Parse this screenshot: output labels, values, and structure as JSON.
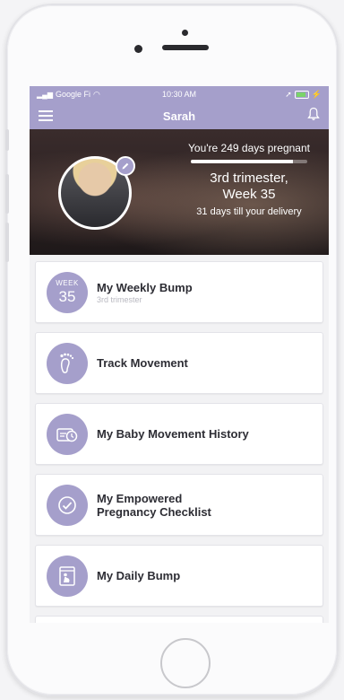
{
  "status_bar": {
    "carrier": "Google Fi",
    "time": "10:30 AM"
  },
  "header": {
    "title": "Sarah",
    "menu_icon": "menu-icon",
    "bell_icon": "bell-icon"
  },
  "hero": {
    "pregnant_days": "You're 249 days pregnant",
    "progress_fraction": 0.88,
    "trimester_line1": "3rd trimester,",
    "trimester_line2": "Week 35",
    "delivery": "31 days till your delivery"
  },
  "cards": [
    {
      "title": "My Weekly Bump",
      "subtitle": "3rd trimester",
      "badge_top": "WEEK",
      "badge_num": "35",
      "icon": "week-badge"
    },
    {
      "title": "Track Movement",
      "icon": "footprint-icon"
    },
    {
      "title": "My Baby Movement History",
      "icon": "history-icon"
    },
    {
      "title_line1": "My Empowered",
      "title_line2": "Pregnancy Checklist",
      "icon": "check-circle-icon"
    },
    {
      "title": "My Daily Bump",
      "icon": "daily-bump-icon"
    }
  ],
  "colors": {
    "accent": "#a59fcb",
    "title_text": "#2d2d34"
  }
}
